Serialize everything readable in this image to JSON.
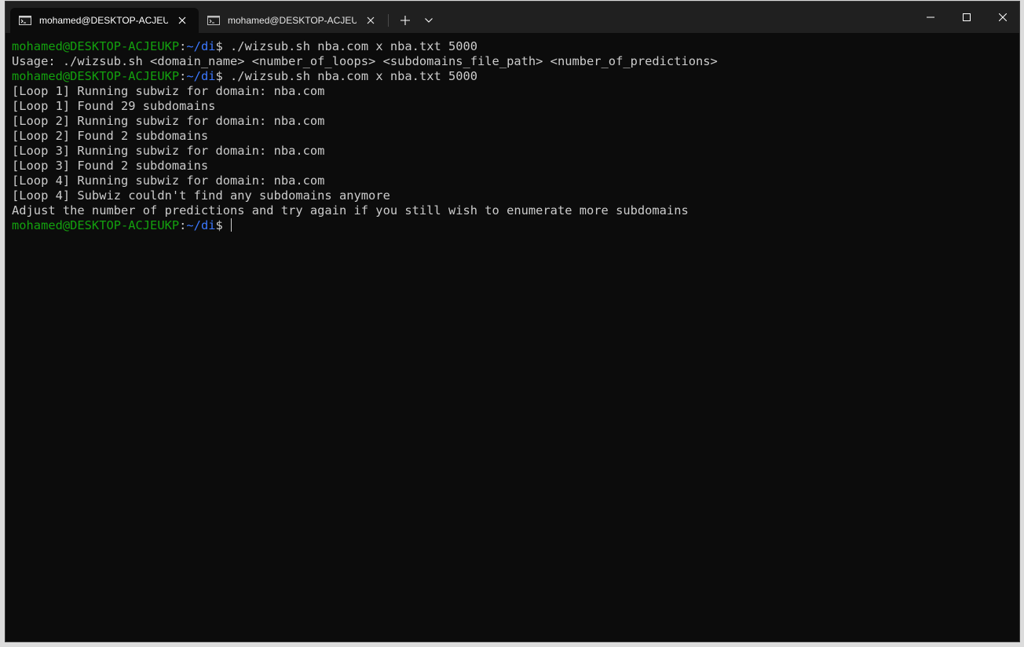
{
  "tabs": [
    {
      "title": "mohamed@DESKTOP-ACJEUKP: ~/di",
      "active": true
    },
    {
      "title": "mohamed@DESKTOP-ACJEUKP: ~/di",
      "active": false
    }
  ],
  "icons": {
    "tab_icon": "terminal-icon",
    "tab_close": "close-icon",
    "new_tab": "plus-icon",
    "dropdown": "chevron-down-icon",
    "minimize": "minimize-icon",
    "maximize": "maximize-icon",
    "close": "close-icon"
  },
  "colors": {
    "background": "#0c0c0c",
    "titlebar": "#202020",
    "foreground": "#cccccc",
    "user_host": "#13a10e",
    "path": "#3b78ff"
  },
  "terminal": {
    "prompt_user_host": "mohamed@DESKTOP-ACJEUKP",
    "prompt_colon": ":",
    "prompt_path": "~/di",
    "prompt_dollar": "$ ",
    "lines": [
      {
        "type": "prompt",
        "command": "./wizsub.sh nba.com x nba.txt 5000"
      },
      {
        "type": "output",
        "text": "Usage: ./wizsub.sh <domain_name> <number_of_loops> <subdomains_file_path> <number_of_predictions>"
      },
      {
        "type": "prompt",
        "command": "./wizsub.sh nba.com x nba.txt 5000"
      },
      {
        "type": "output",
        "text": "[Loop 1] Running subwiz for domain: nba.com"
      },
      {
        "type": "output",
        "text": "[Loop 1] Found 29 subdomains"
      },
      {
        "type": "output",
        "text": "[Loop 2] Running subwiz for domain: nba.com"
      },
      {
        "type": "output",
        "text": "[Loop 2] Found 2 subdomains"
      },
      {
        "type": "output",
        "text": "[Loop 3] Running subwiz for domain: nba.com"
      },
      {
        "type": "output",
        "text": "[Loop 3] Found 2 subdomains"
      },
      {
        "type": "output",
        "text": "[Loop 4] Running subwiz for domain: nba.com"
      },
      {
        "type": "output",
        "text": "[Loop 4] Subwiz couldn't find any subdomains anymore"
      },
      {
        "type": "output",
        "text": "Adjust the number of predictions and try again if you still wish to enumerate more subdomains"
      },
      {
        "type": "prompt",
        "command": "",
        "cursor": true
      }
    ]
  }
}
